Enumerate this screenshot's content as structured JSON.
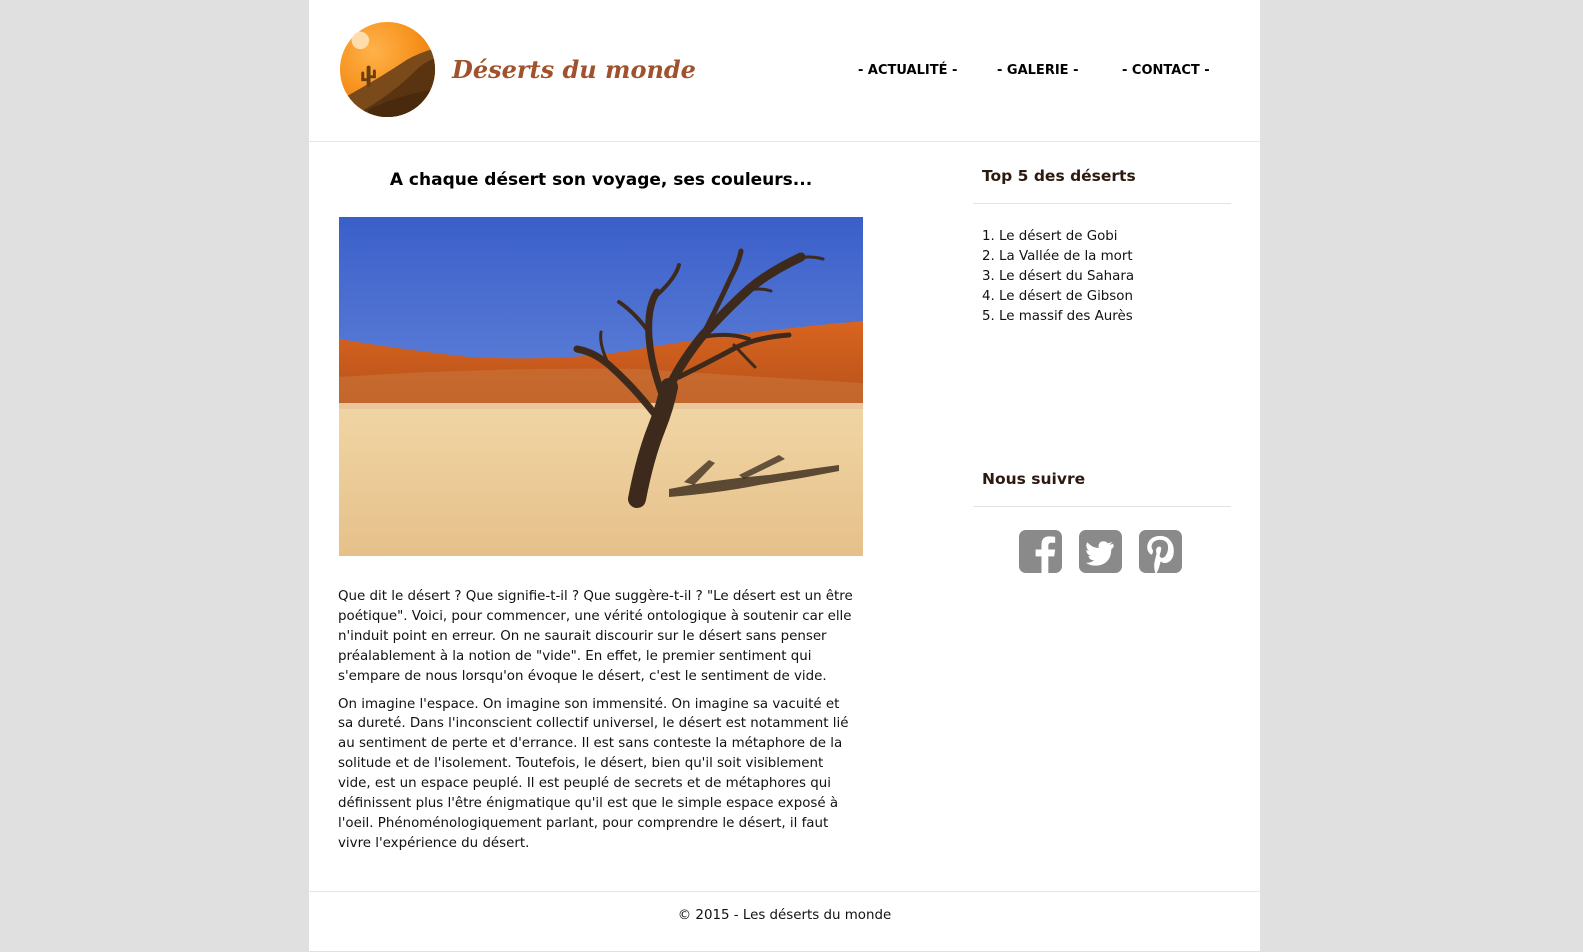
{
  "site": {
    "title": "Déserts du monde",
    "brand_color": "#a0522d",
    "logo_icon": "desert-cactus-logo"
  },
  "nav": {
    "items": [
      {
        "label": "- ACTUALITÉ -"
      },
      {
        "label": "- GALERIE -"
      },
      {
        "label": "- CONTACT -"
      }
    ]
  },
  "main": {
    "title": "A chaque désert son voyage, ses couleurs...",
    "image_icon": "dead-tree-desert-photo",
    "paragraphs": [
      "Que dit le désert ? Que signifie-t-il ? Que suggère-t-il ? \"Le désert est un être poétique\". Voici, pour commencer, une vérité ontologique à soutenir car elle n'induit point en erreur. On ne saurait discourir sur le désert sans penser préalablement à la notion de \"vide\". En effet, le premier sentiment qui s'empare de nous lorsqu'on évoque le désert, c'est le sentiment de vide.",
      "On imagine l'espace. On imagine son immensité. On imagine sa vacuité et sa dureté. Dans l'inconscient collectif universel, le désert est notamment lié au sentiment de perte et d'errance. Il est sans conteste la métaphore de la solitude et de l'isolement. Toutefois, le désert, bien qu'il soit visiblement vide, est un espace peuplé. Il est peuplé de secrets et de métaphores qui définissent plus l'être énigmatique qu'il est que le simple espace exposé à l'oeil. Phénoménologiquement parlant, pour comprendre le désert, il faut vivre l'expérience du désert."
    ]
  },
  "sidebar": {
    "top_heading": "Top 5 des déserts",
    "top_items": [
      {
        "label": "1. Le désert de Gobi"
      },
      {
        "label": "2. La Vallée de la mort"
      },
      {
        "label": "3. Le désert du Sahara"
      },
      {
        "label": "4. Le désert de Gibson"
      },
      {
        "label": "5. Le massif des Aurès"
      }
    ],
    "follow_heading": "Nous suivre",
    "social": [
      {
        "icon": "facebook-icon"
      },
      {
        "icon": "twitter-icon"
      },
      {
        "icon": "pinterest-icon"
      }
    ],
    "social_color": "#8a8a8a"
  },
  "footer": {
    "text": "© 2015 - Les déserts du monde"
  }
}
